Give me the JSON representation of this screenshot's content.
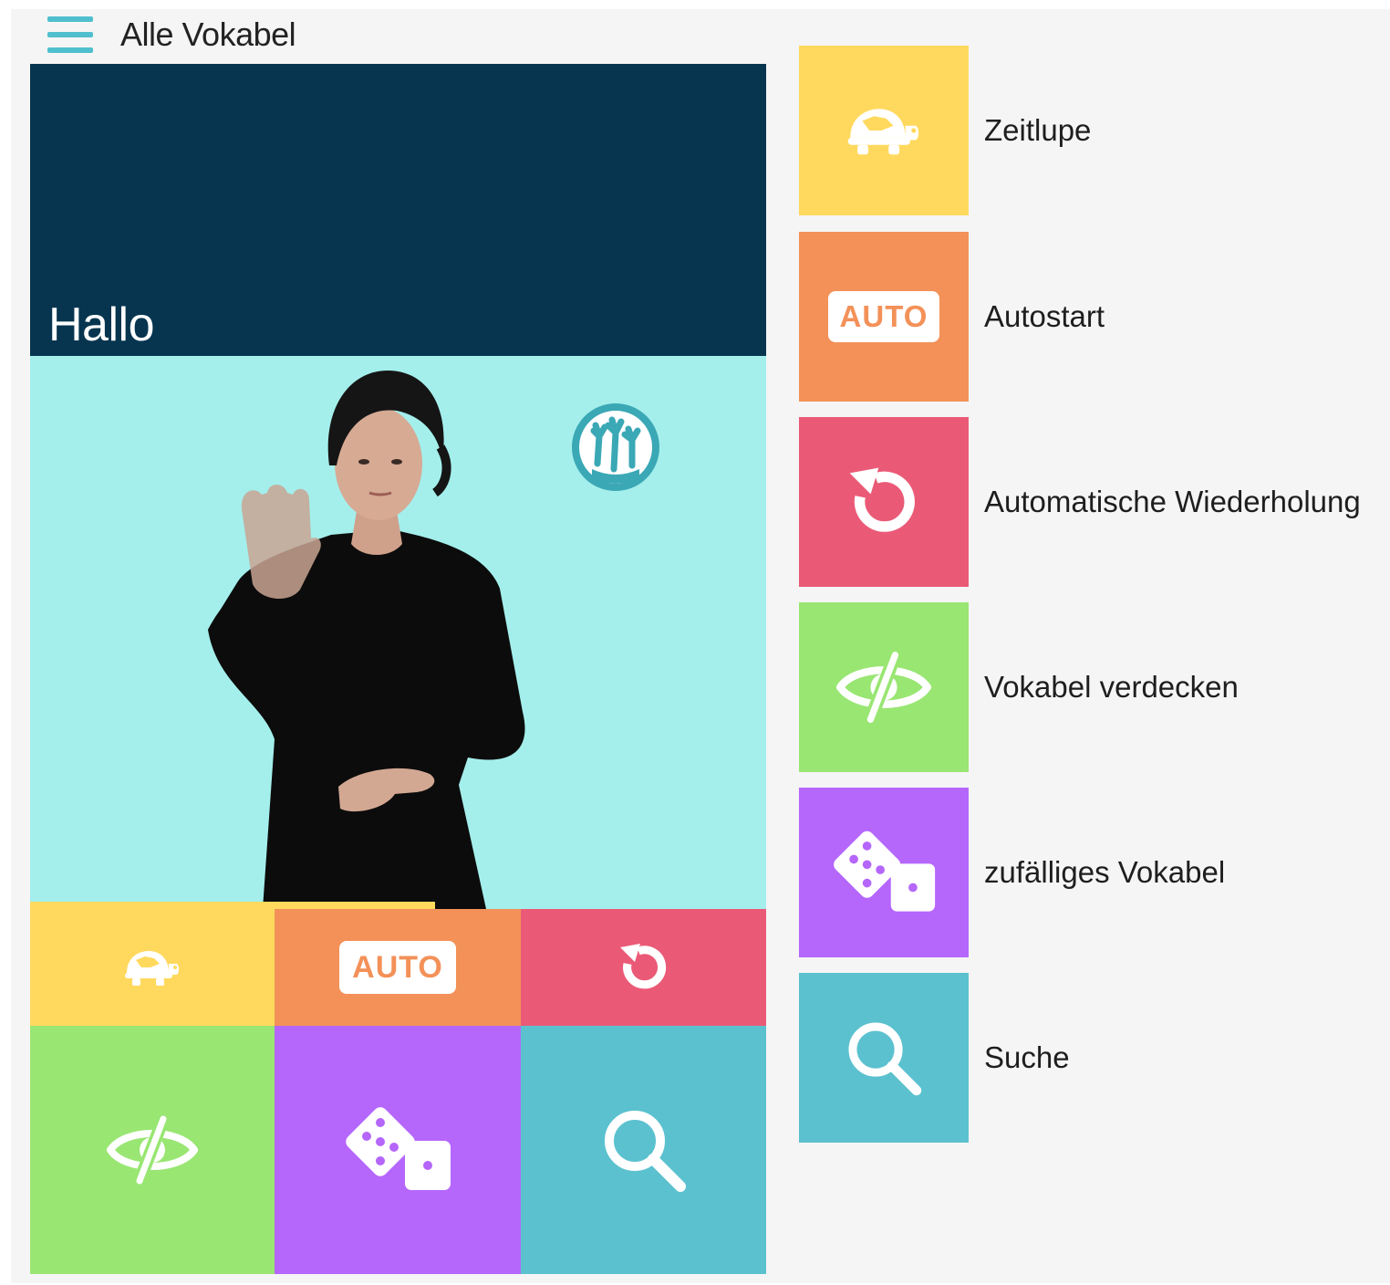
{
  "header": {
    "title": "Alle Vokabel"
  },
  "vocab": {
    "word": "Hallo",
    "progress": 0.55
  },
  "controls": {
    "auto_label": "AUTO"
  },
  "legend": {
    "items": [
      {
        "icon": "turtle-icon",
        "label": "Zeitlupe",
        "color": "#ffd95e"
      },
      {
        "icon": "auto-icon",
        "label": "Autostart",
        "color": "#f39159"
      },
      {
        "icon": "repeat-icon",
        "label": "Automatische Wiederholung",
        "color": "#ea5a77"
      },
      {
        "icon": "eye-slash-icon",
        "label": "Vokabel verdecken",
        "color": "#99e673"
      },
      {
        "icon": "dice-icon",
        "label": "zufälliges Vokabel",
        "color": "#b566fb"
      },
      {
        "icon": "search-icon",
        "label": "Suche",
        "color": "#5bc1cf"
      }
    ]
  },
  "colors": {
    "header_bg": "#07354f",
    "video_bg": "#a4efec",
    "accent_teal": "#4fbfce"
  }
}
